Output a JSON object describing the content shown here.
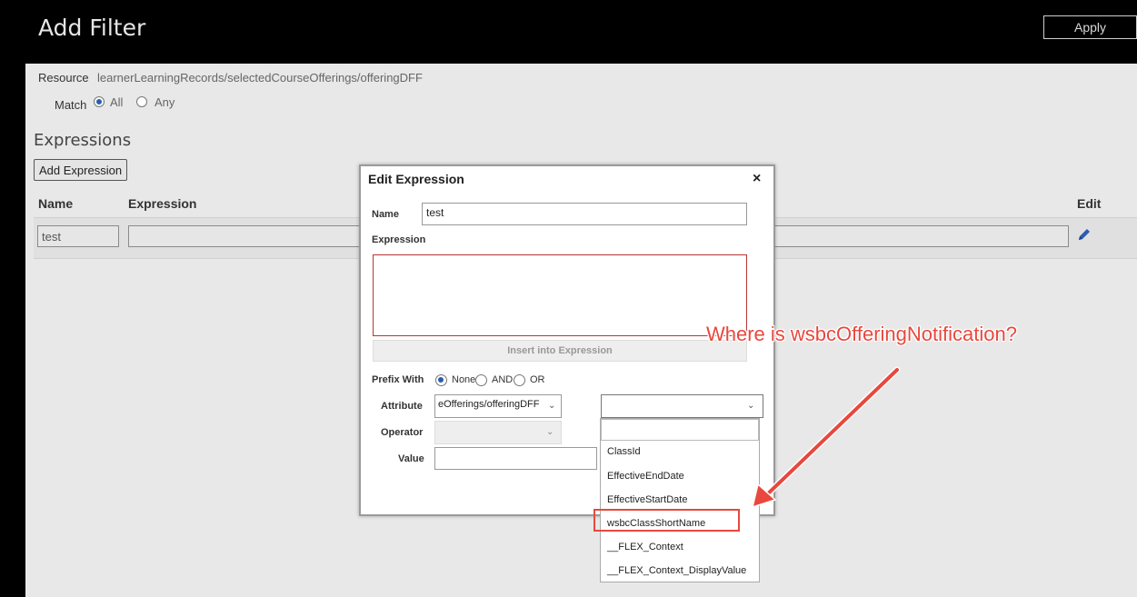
{
  "header": {
    "title": "Add Filter",
    "apply_label": "Apply"
  },
  "resource": {
    "label": "Resource",
    "value": "learnerLearningRecords/selectedCourseOfferings/offeringDFF"
  },
  "match": {
    "label": "Match",
    "all": "All",
    "any": "Any",
    "selected": "All"
  },
  "expressions": {
    "heading": "Expressions",
    "add_label": "Add Expression",
    "columns": {
      "name": "Name",
      "expression": "Expression",
      "edit": "Edit"
    },
    "rows": [
      {
        "name": "test",
        "expression": ""
      }
    ]
  },
  "dialog": {
    "title": "Edit Expression",
    "close": "×",
    "name_label": "Name",
    "name_value": "test",
    "expression_label": "Expression",
    "expression_value": "",
    "insert_label": "Insert into Expression",
    "prefix_label": "Prefix With",
    "prefix_none": "None",
    "prefix_and": "AND",
    "prefix_or": "OR",
    "prefix_selected": "None",
    "attribute_label": "Attribute",
    "attribute_value": "eOfferings/offeringDFF",
    "attribute2_value": "",
    "operator_label": "Operator",
    "operator_value": "",
    "value_label": "Value",
    "value_value": ""
  },
  "dropdown": {
    "options": [
      "",
      "ClassId",
      "EffectiveEndDate",
      "EffectiveStartDate",
      "wsbcClassShortName",
      "__FLEX_Context",
      "__FLEX_Context_DisplayValue"
    ],
    "highlighted": "wsbcClassShortName"
  },
  "annotation": {
    "callout": "Where is wsbcOfferingNotification?",
    "color": "#e8483e"
  },
  "colors": {
    "accent": "#2a5db0",
    "annotation": "#e8483e"
  }
}
